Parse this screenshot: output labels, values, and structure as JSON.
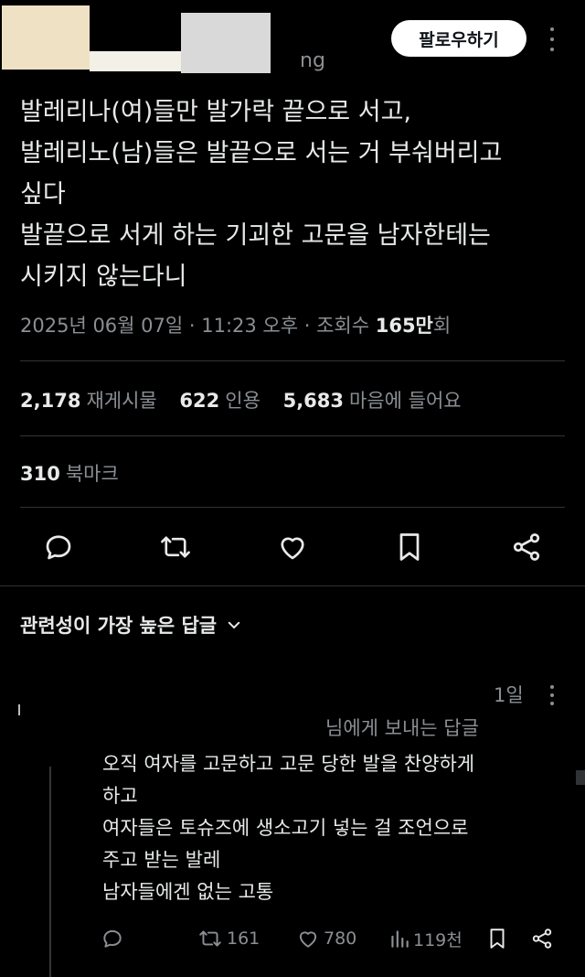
{
  "header": {
    "handle_tail": "ng",
    "follow_label": "팔로우하기"
  },
  "tweet": {
    "lines": [
      "발레리나(여)들만 발가락 끝으로 서고,",
      "발레리노(남)들은 발끝으로 서는 거 부숴버리고",
      "싶다",
      "발끝으로 서게 하는 기괴한 고문을 남자한테는",
      "시키지 않는다니"
    ],
    "timestamp": "2025년 06월 07일 · 11:23 오후 · 조회수 ",
    "views_number": "165만",
    "views_suffix": "회"
  },
  "stats": {
    "retweets_count": "2,178",
    "retweets_label": "재게시물",
    "quotes_count": "622",
    "quotes_label": "인용",
    "likes_count": "5,683",
    "likes_label": "마음에 들어요",
    "bookmarks_count": "310",
    "bookmarks_label": "북마크"
  },
  "actions": [
    "reply-icon",
    "retweet-icon",
    "heart-icon",
    "bookmark-icon",
    "share-icon"
  ],
  "replies": {
    "sort_label": "관련성이 가장 높은 답글",
    "reply": {
      "time": "1일",
      "reply_to": "님에게 보내는 답글",
      "lines": [
        "오직 여자를 고문하고 고문 당한 발을 찬양하게",
        "하고",
        "여자들은 토슈즈에 생소고기 넣는 걸 조언으로",
        "주고 받는 발레",
        "남자들에겐 없는 고통"
      ],
      "retweets": "161",
      "likes": "780",
      "views": "119천"
    }
  },
  "colors": {
    "background": "#000000",
    "text": "#e7e9ea",
    "secondary": "#8b8f94",
    "divider": "#2f3336"
  }
}
